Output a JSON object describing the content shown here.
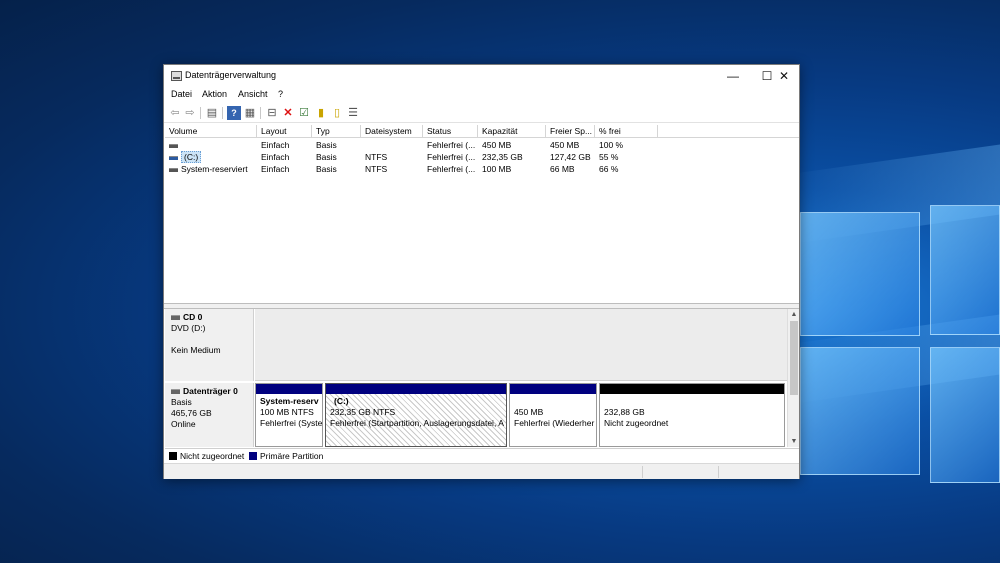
{
  "window": {
    "title": "Datenträgerverwaltung",
    "controls": {
      "minimize": "—",
      "maximize": "☐",
      "close": "✕"
    }
  },
  "menu": [
    "Datei",
    "Aktion",
    "Ansicht",
    "?"
  ],
  "toolbar_icons": [
    "back-arrow-icon",
    "forward-arrow-icon",
    "console-tree-icon",
    "help-icon",
    "properties-icon",
    "connect-drive-icon",
    "delete-icon",
    "check-icon",
    "new-document-icon",
    "open-document-icon",
    "list-view-icon"
  ],
  "volume_table": {
    "columns": [
      "Volume",
      "Layout",
      "Typ",
      "Dateisystem",
      "Status",
      "Kapazität",
      "Freier Sp...",
      "% frei"
    ],
    "rows": [
      {
        "volume": "",
        "layout": "Einfach",
        "typ": "Basis",
        "dateisystem": "",
        "status": "Fehlerfrei (...",
        "kapazitaet": "450 MB",
        "frei": "450 MB",
        "prozent": "100 %"
      },
      {
        "volume": "(C:)",
        "layout": "Einfach",
        "typ": "Basis",
        "dateisystem": "NTFS",
        "status": "Fehlerfrei (...",
        "kapazitaet": "232,35 GB",
        "frei": "127,42 GB",
        "prozent": "55 %"
      },
      {
        "volume": "System-reserviert",
        "layout": "Einfach",
        "typ": "Basis",
        "dateisystem": "NTFS",
        "status": "Fehlerfrei (...",
        "kapazitaet": "100 MB",
        "frei": "66 MB",
        "prozent": "66 %"
      }
    ]
  },
  "disks": {
    "cd0": {
      "name": "CD 0",
      "type": "DVD (D:)",
      "state": "Kein Medium"
    },
    "disk0": {
      "name": "Datenträger 0",
      "type": "Basis",
      "size": "465,76 GB",
      "state": "Online",
      "partitions": [
        {
          "title": "System-reserv",
          "line1": "100 MB NTFS",
          "line2": "Fehlerfrei (Syste"
        },
        {
          "title": "(C:)",
          "line1": "232,35 GB NTFS",
          "line2": "Fehlerfrei (Startpartition, Auslagerungsdatei, A"
        },
        {
          "title": "",
          "line1": "450 MB",
          "line2": "Fehlerfrei (Wiederher"
        },
        {
          "title": "",
          "line1": "232,88 GB",
          "line2": "Nicht zugeordnet"
        }
      ]
    }
  },
  "legend": {
    "unallocated": "Nicht zugeordnet",
    "primary": "Primäre Partition",
    "unallocated_color": "#000000",
    "primary_color": "#00007f"
  }
}
